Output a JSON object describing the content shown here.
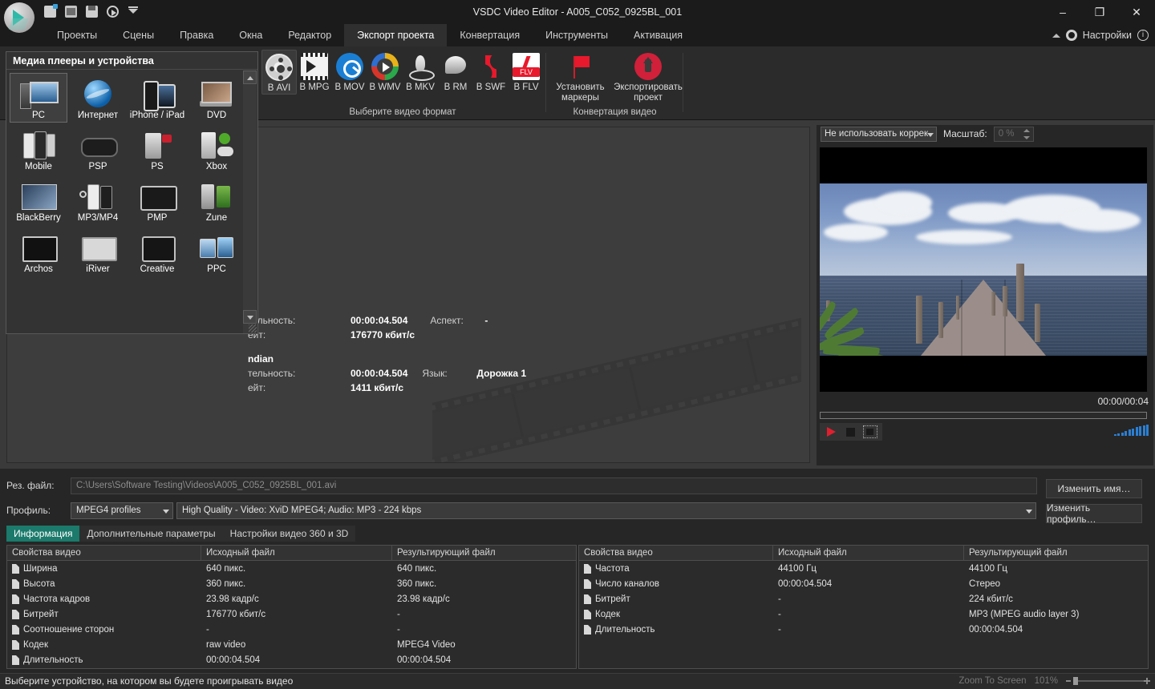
{
  "window": {
    "title": "VSDC Video Editor - A005_C052_0925BL_001",
    "minimize": "–",
    "maximize": "❐",
    "close": "✕"
  },
  "quick_access": [
    "new-project-icon",
    "open-project-icon",
    "save-project-icon",
    "play-icon",
    "more-icon"
  ],
  "menubar": {
    "items": [
      {
        "label": "Проекты",
        "active": false
      },
      {
        "label": "Сцены",
        "active": false
      },
      {
        "label": "Правка",
        "active": false
      },
      {
        "label": "Окна",
        "active": false
      },
      {
        "label": "Редактор",
        "active": false
      },
      {
        "label": "Экспорт проекта",
        "active": true
      },
      {
        "label": "Конвертация",
        "active": false
      },
      {
        "label": "Инструменты",
        "active": false
      },
      {
        "label": "Активация",
        "active": false
      }
    ],
    "settings_label": "Настройки",
    "info_glyph": "i"
  },
  "ribbon": {
    "format_group": {
      "title": "Выберите видео формат",
      "buttons": [
        {
          "label": "В AVI",
          "icon": "avi-icon",
          "selected": true
        },
        {
          "label": "В MPG",
          "icon": "mpg-icon",
          "selected": false
        },
        {
          "label": "В MOV",
          "icon": "mov-icon",
          "selected": false
        },
        {
          "label": "В WMV",
          "icon": "wmv-icon",
          "selected": false
        },
        {
          "label": "В MKV",
          "icon": "mkv-icon",
          "selected": false
        },
        {
          "label": "В RM",
          "icon": "rm-icon",
          "selected": false
        },
        {
          "label": "В SWF",
          "icon": "swf-icon",
          "selected": false
        },
        {
          "label": "В FLV",
          "icon": "flv-icon",
          "selected": false
        }
      ]
    },
    "convert_group": {
      "title": "Конвертация видео",
      "buttons": [
        {
          "label": "Установить маркеры",
          "icon": "flag-icon"
        },
        {
          "label": "Экспортировать проект",
          "icon": "export-icon"
        }
      ]
    }
  },
  "device_panel": {
    "title": "Медиа плееры и устройства",
    "devices": [
      {
        "label": "PC",
        "icon": "pc-icon",
        "selected": true
      },
      {
        "label": "Интернет",
        "icon": "internet-icon",
        "selected": false
      },
      {
        "label": "iPhone / iPad",
        "icon": "iphone-ipad-icon",
        "selected": false
      },
      {
        "label": "DVD",
        "icon": "dvd-icon",
        "selected": false
      },
      {
        "label": "Mobile",
        "icon": "mobile-icon",
        "selected": false
      },
      {
        "label": "PSP",
        "icon": "psp-icon",
        "selected": false
      },
      {
        "label": "PS",
        "icon": "playstation-icon",
        "selected": false
      },
      {
        "label": "Xbox",
        "icon": "xbox-icon",
        "selected": false
      },
      {
        "label": "BlackBerry",
        "icon": "blackberry-icon",
        "selected": false
      },
      {
        "label": "MP3/MP4",
        "icon": "mp3-mp4-icon",
        "selected": false
      },
      {
        "label": "PMP",
        "icon": "pmp-icon",
        "selected": false
      },
      {
        "label": "Zune",
        "icon": "zune-icon",
        "selected": false
      },
      {
        "label": "Archos",
        "icon": "archos-icon",
        "selected": false
      },
      {
        "label": "iRiver",
        "icon": "iriver-icon",
        "selected": false
      },
      {
        "label": "Creative",
        "icon": "creative-icon",
        "selected": false
      },
      {
        "label": "PPC",
        "icon": "ppc-icon",
        "selected": false
      }
    ]
  },
  "workspace_info": {
    "video": {
      "duration_key": "тельность:",
      "duration_value": "00:00:04.504",
      "aspect_key": "Аспект:",
      "aspect_value": "-",
      "bitrate_key": "ейт:",
      "bitrate_value": "176770 кбит/с"
    },
    "audio": {
      "header": "ndian",
      "duration_key": "тельность:",
      "duration_value": "00:00:04.504",
      "lang_key": "Язык:",
      "lang_value": "Дорожка 1",
      "bitrate_key": "ейт:",
      "bitrate_value": "1411 кбит/с"
    }
  },
  "preview": {
    "correction_select": "Не использовать коррек",
    "scale_label": "Масштаб:",
    "scale_value": "0 %",
    "time_display": "00:00/00:04",
    "controls": [
      "play-button",
      "stop-button",
      "fullscreen-button"
    ],
    "vu_levels": [
      2,
      3,
      4,
      6,
      8,
      9,
      11,
      12,
      13,
      14
    ]
  },
  "output": {
    "file_label": "Рез. файл:",
    "file_path": "C:\\Users\\Software Testing\\Videos\\A005_C052_0925BL_001.avi",
    "profile_label": "Профиль:",
    "profile_family": "MPEG4 profiles",
    "profile_detail": "High Quality - Video: XviD MPEG4; Audio: MP3 - 224 kbps",
    "rename_button": "Изменить имя…",
    "change_profile_button": "Изменить профиль…"
  },
  "tabs": [
    {
      "label": "Информация",
      "active": true
    },
    {
      "label": "Дополнительные параметры",
      "active": false
    },
    {
      "label": "Настройки видео 360 и 3D",
      "active": false
    }
  ],
  "table_video": {
    "headers": [
      "Свойства видео",
      "Исходный файл",
      "Результирующий файл"
    ],
    "rows": [
      {
        "property": "Ширина",
        "source": "640 пикс.",
        "result": "640 пикс."
      },
      {
        "property": "Высота",
        "source": "360 пикс.",
        "result": "360 пикс."
      },
      {
        "property": "Частота кадров",
        "source": "23.98 кадр/с",
        "result": "23.98 кадр/с"
      },
      {
        "property": "Битрейт",
        "source": "176770 кбит/с",
        "result": "-"
      },
      {
        "property": "Соотношение сторон",
        "source": "-",
        "result": "-"
      },
      {
        "property": "Кодек",
        "source": "raw video",
        "result": "MPEG4 Video"
      },
      {
        "property": "Длительность",
        "source": "00:00:04.504",
        "result": "00:00:04.504"
      }
    ]
  },
  "table_audio": {
    "headers": [
      "Свойства видео",
      "Исходный файл",
      "Результирующий файл"
    ],
    "rows": [
      {
        "property": "Частота",
        "source": "44100 Гц",
        "result": "44100 Гц"
      },
      {
        "property": "Число каналов",
        "source": "00:00:04.504",
        "result": "Стерео"
      },
      {
        "property": "Битрейт",
        "source": "-",
        "result": "224 кбит/с"
      },
      {
        "property": "Кодек",
        "source": "-",
        "result": "MP3 (MPEG audio layer 3)"
      },
      {
        "property": "Длительность",
        "source": "-",
        "result": "00:00:04.504"
      }
    ]
  },
  "statusbar": {
    "hint": "Выберите устройство, на котором вы будете проигрывать видео",
    "zoom_label": "Zoom To Screen",
    "zoom_value": "101%"
  },
  "colors": {
    "accent": "#1b7a6b",
    "red": "#e8192c",
    "blue": "#2b7fd4",
    "panel": "#2b2b2b"
  }
}
